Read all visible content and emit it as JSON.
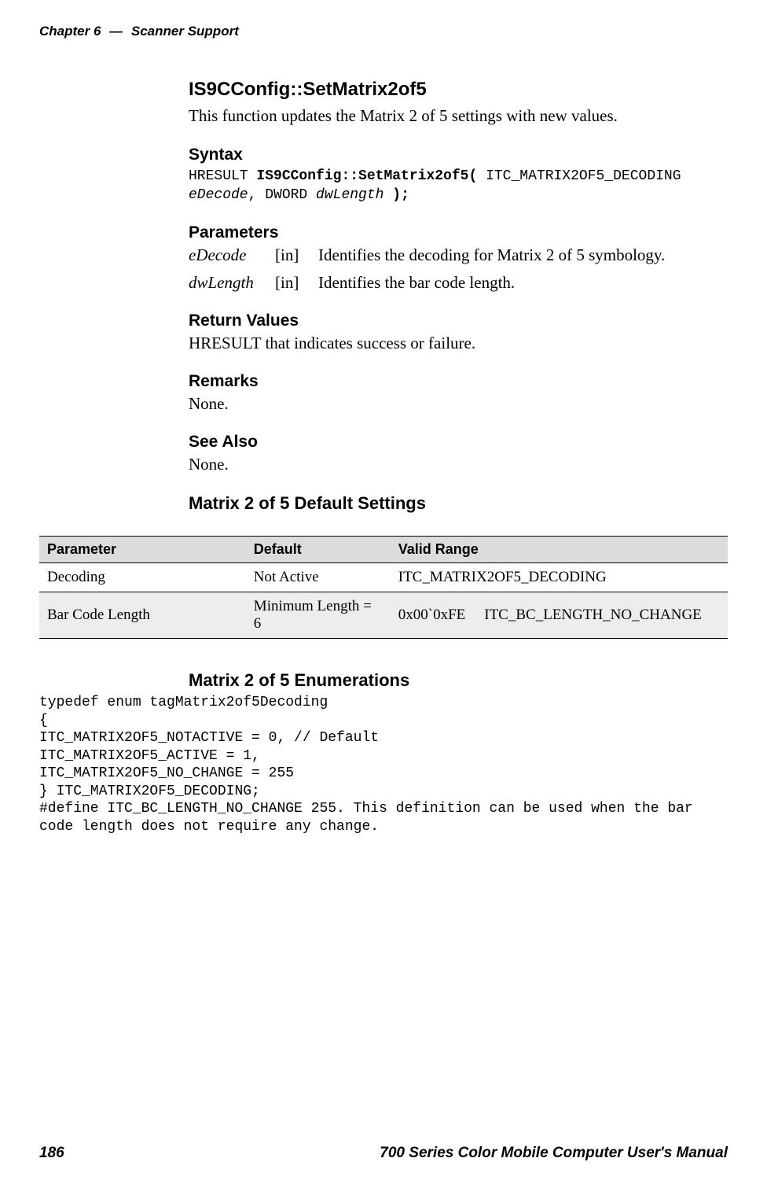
{
  "header": {
    "chapter": "Chapter 6",
    "separator": "—",
    "section": "Scanner Support"
  },
  "main": {
    "title": "IS9CConfig::SetMatrix2of5",
    "description": "This function updates the Matrix 2 of 5 settings with new values.",
    "syntax": {
      "heading": "Syntax",
      "line1_prefix": "HRESULT ",
      "line1_bold": "IS9CConfig::SetMatrix2of5(",
      "line1_suffix": " ITC_MATRIX2OF5_DECODING",
      "line2_italic1": "eDecode",
      "line2_mid": ", DWORD ",
      "line2_italic2": "dwLength",
      "line2_bold_end": " );"
    },
    "parameters": {
      "heading": "Parameters",
      "rows": [
        {
          "name": "eDecode",
          "in": "[in]",
          "desc": "Identifies the decoding for Matrix 2 of 5 symbology."
        },
        {
          "name": "dwLength",
          "in": "[in]",
          "desc": "Identifies the bar code length."
        }
      ]
    },
    "returnValues": {
      "heading": "Return Values",
      "text": "HRESULT that indicates success or failure."
    },
    "remarks": {
      "heading": "Remarks",
      "text": "None."
    },
    "seeAlso": {
      "heading": "See Also",
      "text": "None."
    },
    "defaultSettings": {
      "heading": "Matrix 2 of 5 Default Settings"
    }
  },
  "table": {
    "headers": [
      "Parameter",
      "Default",
      "Valid Range"
    ],
    "rows": [
      {
        "param": "Decoding",
        "default": "Not Active",
        "range1": "ITC_MATRIX2OF5_DECODING",
        "range2": ""
      },
      {
        "param": "Bar Code Length",
        "default": "Minimum Length = 6",
        "range1": "0x00`0xFE",
        "range2": "ITC_BC_LENGTH_NO_CHANGE"
      }
    ]
  },
  "enumerations": {
    "heading": "Matrix 2 of 5 Enumerations",
    "code": "typedef enum tagMatrix2of5Decoding\n{\nITC_MATRIX2OF5_NOTACTIVE = 0, // Default\nITC_MATRIX2OF5_ACTIVE = 1,\nITC_MATRIX2OF5_NO_CHANGE = 255\n} ITC_MATRIX2OF5_DECODING;\n#define ITC_BC_LENGTH_NO_CHANGE 255. This definition can be used when the bar\ncode length does not require any change."
  },
  "footer": {
    "pageNumber": "186",
    "manualTitle": "700 Series Color Mobile Computer User's Manual"
  }
}
